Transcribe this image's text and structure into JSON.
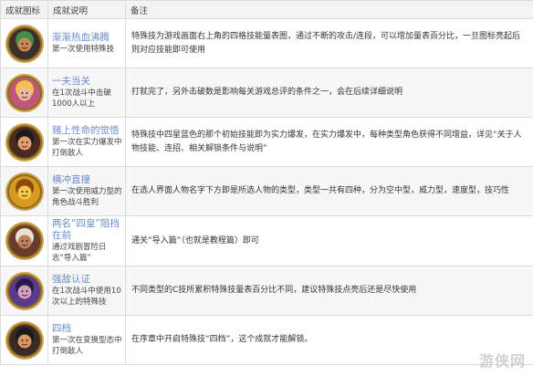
{
  "headers": {
    "icon": "成就图标",
    "desc": "成就说明",
    "note": "备注"
  },
  "rows": [
    {
      "icon": "zoro-portrait-icon",
      "title": "渐渐热血沸腾",
      "desc": "第一次使用特殊技",
      "note": "特殊技为游戏画面右上角的四格技能量表图，通过不断的攻击/连段，可以增加量表百分比，一旦图标亮起后则对应技能即可使用",
      "bg": "#3a2f2a",
      "skin": "#c98a5a",
      "hair": "#3f8f45"
    },
    {
      "icon": "pink-character-portrait-icon",
      "title": "一夫当关",
      "desc": "在1次战斗中击破1000人以上",
      "note": "打就完了，另外击破数是影响每关游戏总评的条件之一，会在后续详细说明",
      "bg": "#c0567a",
      "skin": "#f0b8a0",
      "hair": "#f2c24a"
    },
    {
      "icon": "luffy-portrait-icon",
      "title": "赌上性命的觉悟",
      "desc": "第一次在实力爆发中打倒敌人",
      "note": "特殊技中四星蓝色的那个初始技能即为实力爆发，在实力爆发中，每种类型角色获得不同增益，详见“关于人物技能、连招、相关解锁条件与说明”",
      "bg": "#4a2a20",
      "skin": "#e0a070",
      "hair": "#1c1c1c"
    },
    {
      "icon": "fist-icon",
      "title": "横冲直撞",
      "desc": "第一次使用威力型的角色战斗胜利",
      "note": "在选人界面人物名字下方即是所选人物的类型，类型一共有四种，分为空中型，威力型，速度型，技巧性",
      "bg": "#d99a20",
      "skin": "#f5c84a",
      "hair": "#8a4a10"
    },
    {
      "icon": "whitebeard-portrait-icon",
      "title": "两名“四皇”阻挡在前",
      "desc": "通过戏剧冒险日志“导入篇”",
      "note": "通关“导入篇”（也就是教程篇）即可",
      "bg": "#6a3a2a",
      "skin": "#c08060",
      "hair": "#e8e0d0"
    },
    {
      "icon": "purple-character-portrait-icon",
      "title": "强敌认证",
      "desc": "在1次战斗中使用10次以上的特殊技",
      "note": "不同类型的C技所累积特殊技量表百分比不同，建议特殊技点亮后还是尽快使用",
      "bg": "#5a3a8a",
      "skin": "#d0a0c0",
      "hair": "#2a1a4a"
    },
    {
      "icon": "luffy-gear-four-portrait-icon",
      "title": "四档",
      "desc": "第一次在变换型态中打倒敌人",
      "note": "在序章中开启特殊技“四档”，这个成就才能解锁。",
      "bg": "#3a2a26",
      "skin": "#d89868",
      "hair": "#1a1a1a"
    }
  ],
  "watermark": "游侠网"
}
